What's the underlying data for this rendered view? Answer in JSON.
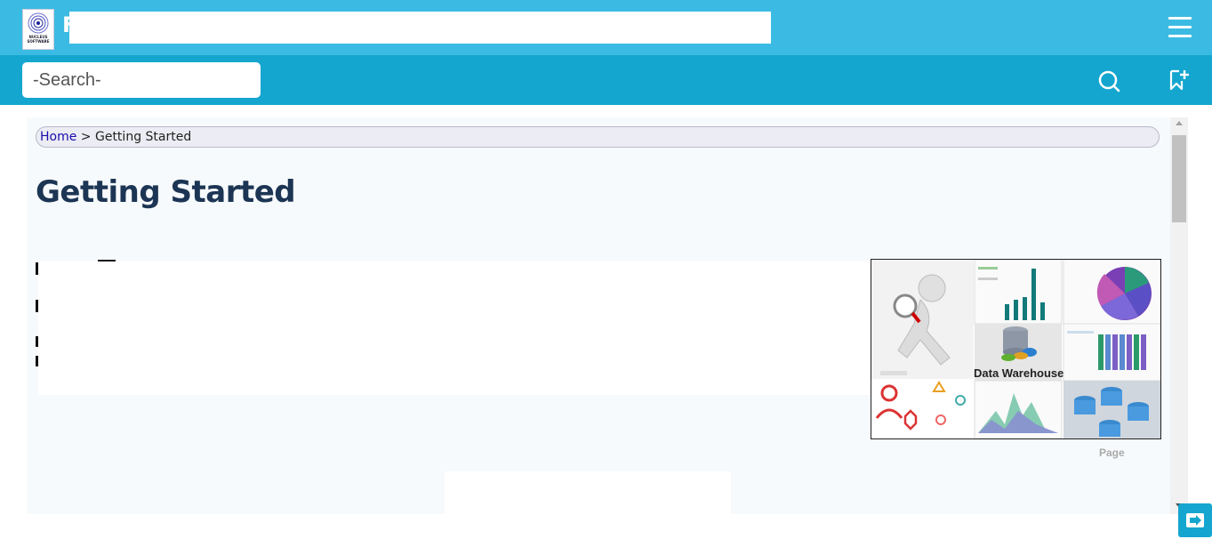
{
  "header": {
    "logo_text": "NUCLEUS SOFTWARE",
    "title_fragment": "F",
    "menu_icon": "hamburger-menu-icon"
  },
  "search": {
    "placeholder": "-Search-",
    "search_icon": "search-icon",
    "bookmark_icon": "bookmark-add-icon"
  },
  "breadcrumb": {
    "home_label": "Home",
    "separator": ">",
    "current": "Getting Started"
  },
  "page": {
    "title": "Getting Started",
    "hero_image_labels": [
      "Data Warehouse"
    ],
    "hero_caption": "Page"
  },
  "footer": {
    "next_icon": "next-page-icon"
  },
  "colors": {
    "topbar": "#3bbbe3",
    "searchbar": "#14a6cf",
    "title": "#1c3554"
  }
}
